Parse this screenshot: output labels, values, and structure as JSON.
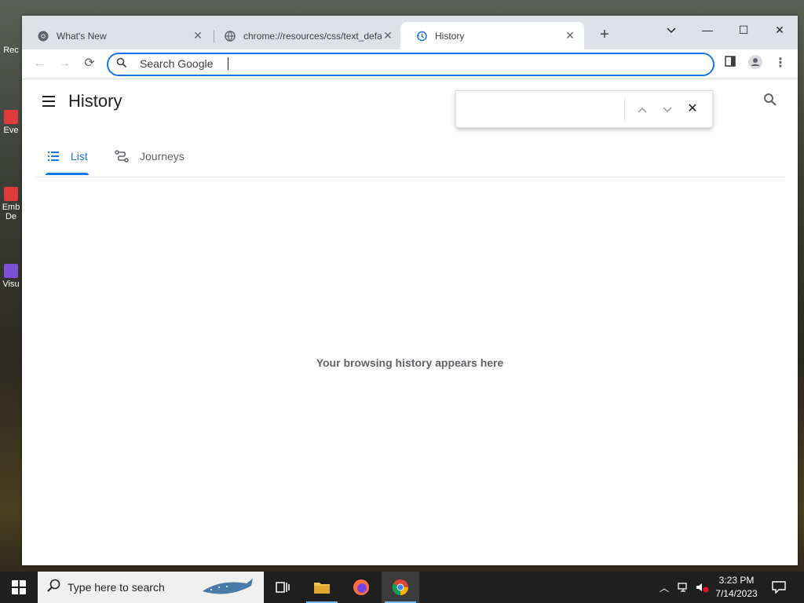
{
  "desktop": {
    "icons": [
      {
        "label": "Rec"
      },
      {
        "label": "Eve"
      },
      {
        "label": "Emb De"
      },
      {
        "label": "Visu"
      }
    ]
  },
  "browser": {
    "tabs": [
      {
        "title": "What's New",
        "icon": "chrome-logo-icon",
        "active": false
      },
      {
        "title": "chrome://resources/css/text_defa",
        "icon": "globe-icon",
        "active": false
      },
      {
        "title": "History",
        "icon": "history-icon",
        "active": true
      }
    ],
    "omnibox": {
      "placeholder": "Search Google",
      "value": ""
    }
  },
  "page": {
    "title": "History",
    "tabs": [
      {
        "label": "List",
        "icon": "list-icon",
        "active": true
      },
      {
        "label": "Journeys",
        "icon": "journeys-icon",
        "active": false
      }
    ],
    "empty_message": "Your browsing history appears here",
    "find": {
      "value": ""
    }
  },
  "taskbar": {
    "search_placeholder": "Type here to search",
    "time": "3:23 PM",
    "date": "7/14/2023"
  },
  "colors": {
    "accent": "#1a73e8",
    "tabstrip": "#dee1e6",
    "taskbar": "#1f1f1f"
  }
}
